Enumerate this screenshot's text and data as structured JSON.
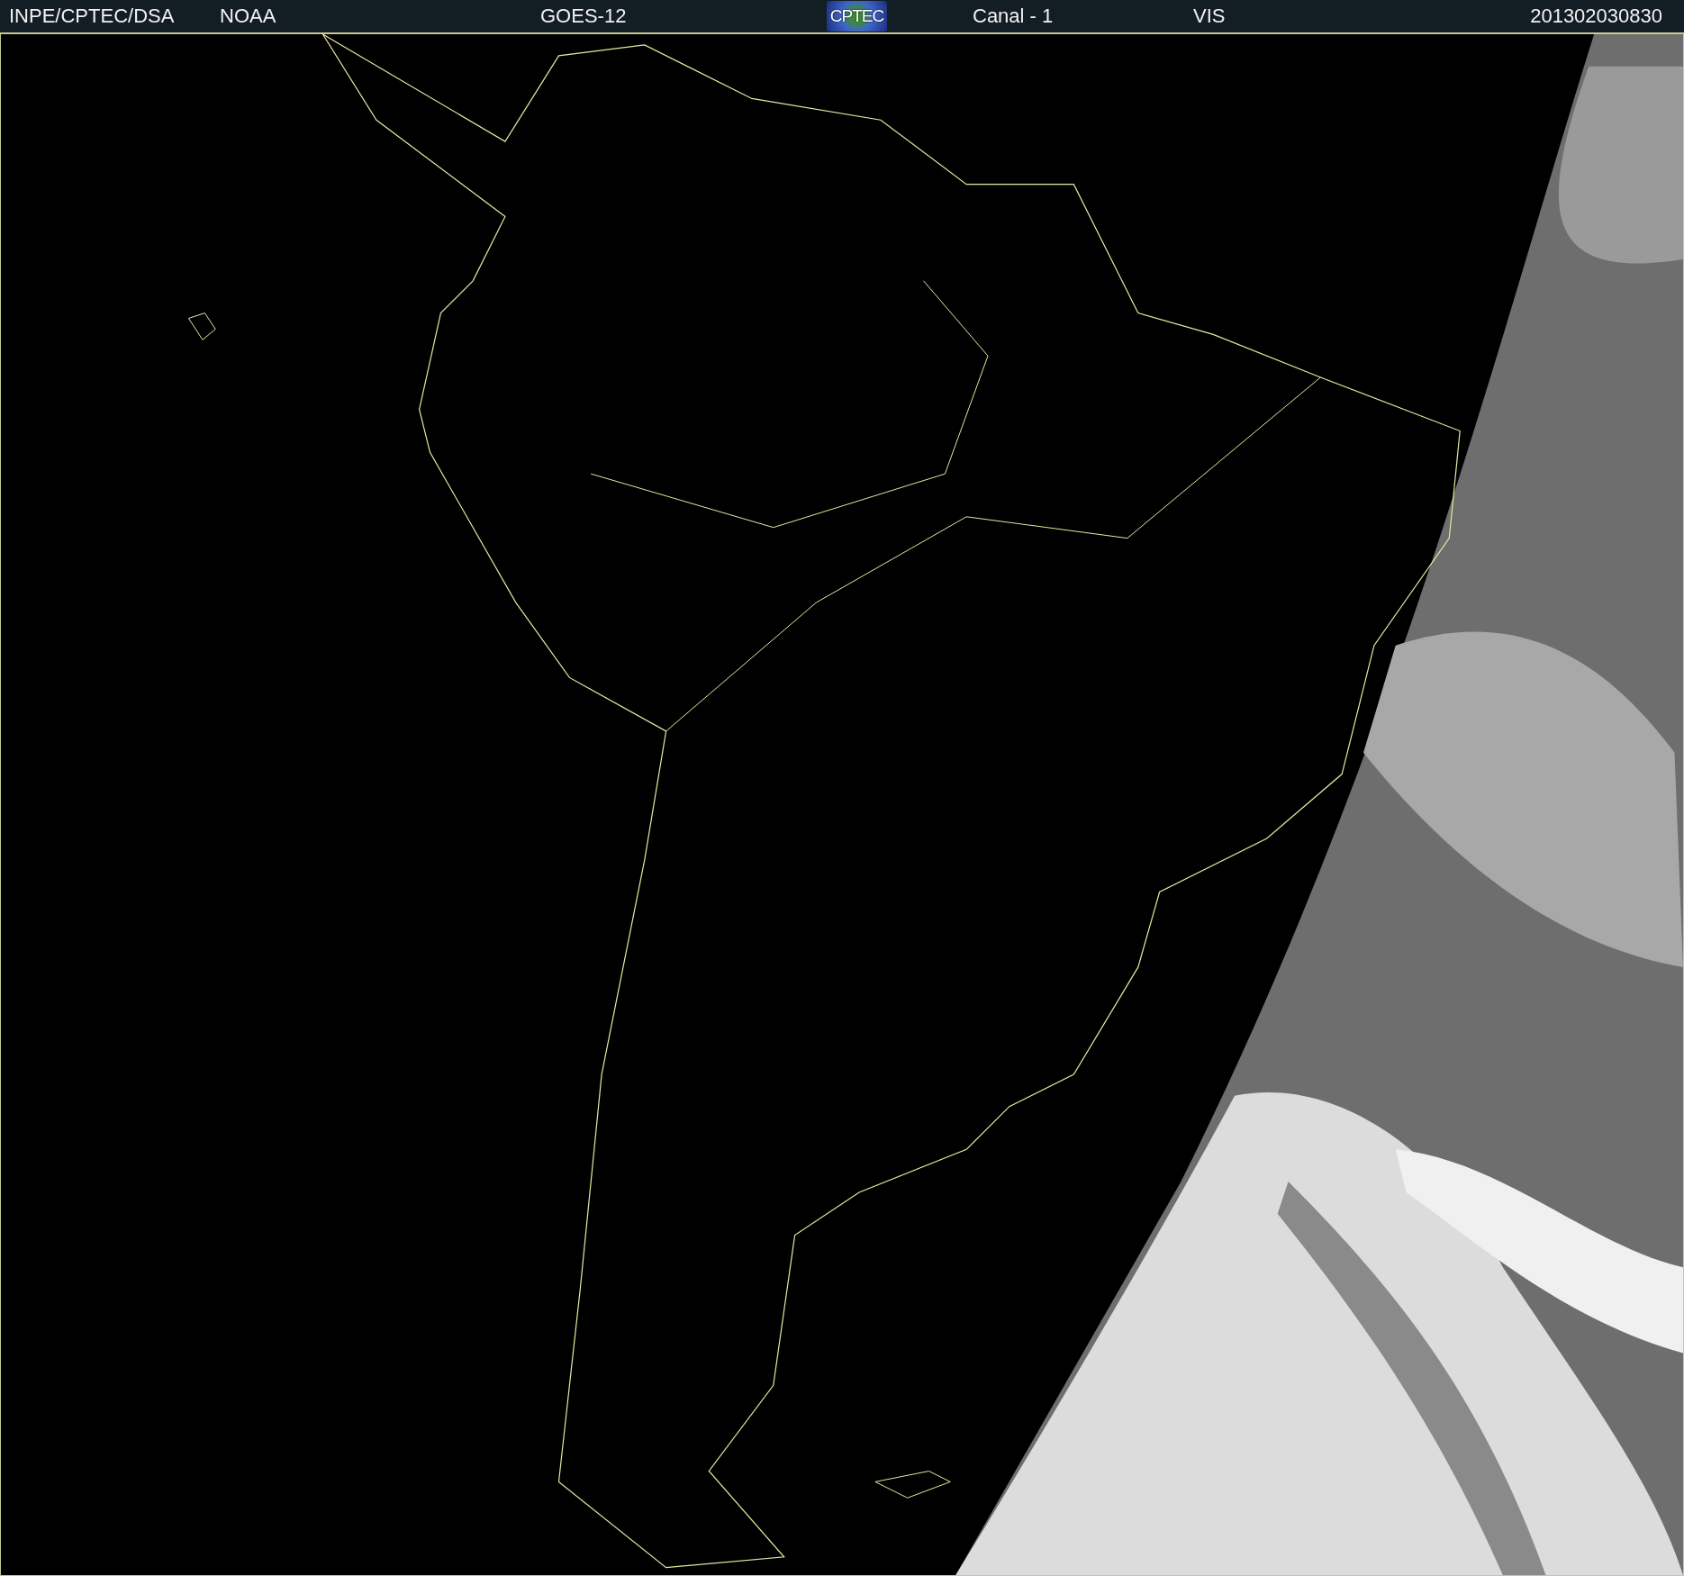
{
  "header": {
    "items": [
      {
        "kind": "text",
        "text": "INPE/CPTEC/DSA"
      },
      {
        "kind": "text",
        "text": "NOAA"
      },
      {
        "kind": "text",
        "text": "GOES-12"
      },
      {
        "kind": "logo",
        "text": "CPTEC"
      },
      {
        "kind": "text",
        "text": "Canal - 1"
      },
      {
        "kind": "text",
        "text": "VIS"
      },
      {
        "kind": "text",
        "text": "201302030830"
      }
    ]
  }
}
